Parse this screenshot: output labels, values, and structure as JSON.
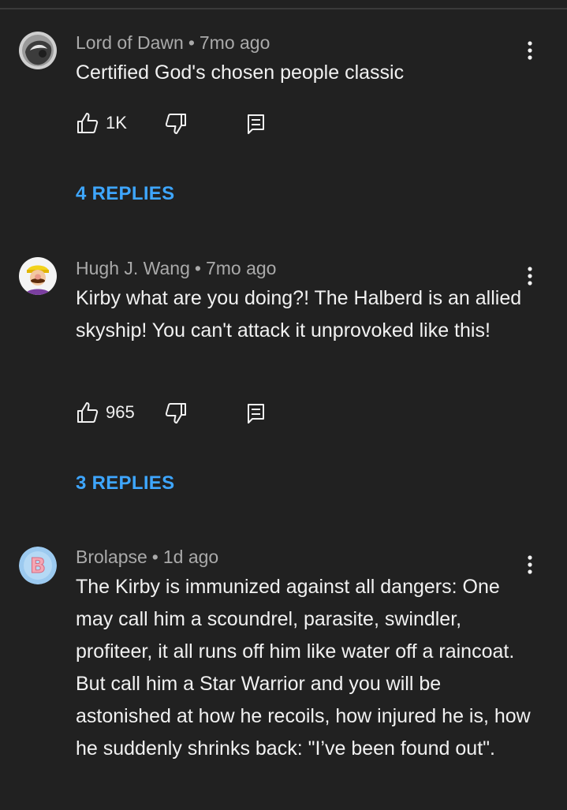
{
  "comments": [
    {
      "author": "Lord of Dawn",
      "separator": "•",
      "time": "7mo ago",
      "text": "Certified God's chosen people classic",
      "likes": "1K",
      "replies_label": "4 REPLIES",
      "avatar_icon": "grey-helmet-avatar"
    },
    {
      "author": "Hugh J. Wang",
      "separator": "•",
      "time": "7mo ago",
      "text": "Kirby what are you doing?! The Halberd is an allied skyship! You can't attack it unprovoked like this!",
      "likes": "965",
      "replies_label": "3 REPLIES",
      "avatar_icon": "wario-avatar"
    },
    {
      "author": "Brolapse",
      "separator": "•",
      "time": "1d ago",
      "text": "The Kirby is immunized against all dangers: One may call him a scoundrel, parasite, swindler, profiteer, it all runs off him like water off a raincoat. But call him a Star Warrior and you will be astonished at how he recoils, how injured he is, how he suddenly shrinks back: \"I’ve been found out\".",
      "avatar_letter": "B",
      "avatar_icon": "letter-b-avatar"
    }
  ],
  "colors": {
    "background": "#212121",
    "text": "#f1f1f1",
    "secondary_text": "#aaaaaa",
    "link": "#3ea6ff"
  }
}
